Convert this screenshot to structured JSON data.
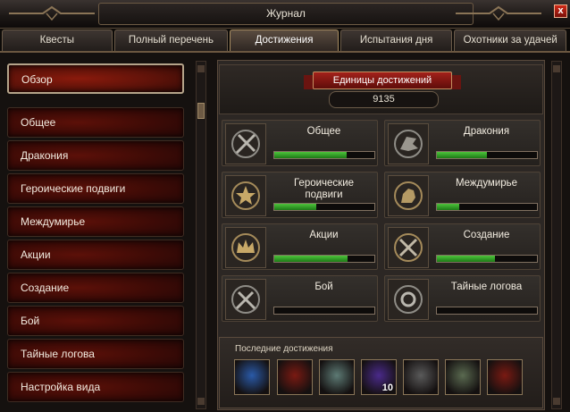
{
  "window": {
    "title": "Журнал",
    "close_label": "x"
  },
  "tabs": [
    {
      "label": "Квесты",
      "active": false
    },
    {
      "label": "Полный перечень",
      "active": false
    },
    {
      "label": "Достижения",
      "active": true
    },
    {
      "label": "Испытания дня",
      "active": false
    },
    {
      "label": "Охотники за удачей",
      "active": false
    }
  ],
  "sidebar": {
    "items": [
      {
        "label": "Обзор",
        "selected": true
      },
      {
        "label": "Общее"
      },
      {
        "label": "Дракония"
      },
      {
        "label": "Героические подвиги"
      },
      {
        "label": "Междумирье"
      },
      {
        "label": "Акции"
      },
      {
        "label": "Создание"
      },
      {
        "label": "Бой"
      },
      {
        "label": "Тайные логова"
      },
      {
        "label": "Настройка вида"
      }
    ]
  },
  "summary": {
    "title": "Единицы достижений",
    "points": "9135"
  },
  "categories": [
    {
      "label": "Общее",
      "icon": "crossed-sword-emblem-icon",
      "progress": 0.72
    },
    {
      "label": "Дракония",
      "icon": "dragon-head-emblem-icon",
      "progress": 0.5
    },
    {
      "label": "Героические\nподвиги",
      "icon": "star-medal-emblem-icon",
      "progress": 0.42
    },
    {
      "label": "Междумирье",
      "icon": "rider-emblem-icon",
      "progress": 0.22
    },
    {
      "label": "Акции",
      "icon": "crown-emblem-icon",
      "progress": 0.73
    },
    {
      "label": "Создание",
      "icon": "crossed-tools-emblem-icon",
      "progress": 0.58
    },
    {
      "label": "Бой",
      "icon": "crossed-swords-emblem-icon",
      "progress": 0
    },
    {
      "label": "Тайные логова",
      "icon": "lair-seal-emblem-icon",
      "progress": 0
    }
  ],
  "recent": {
    "label": "Последние достижения",
    "items": [
      {
        "icon": "blue-spirit-icon",
        "color": "#2a5aa8"
      },
      {
        "icon": "red-demon-icon",
        "color": "#7a1a12"
      },
      {
        "icon": "silver-dragon-icon",
        "color": "#5d7a74"
      },
      {
        "icon": "purple-sorcerer-icon",
        "color": "#4a2a8a",
        "badge": "10"
      },
      {
        "icon": "fire-emblem-icon",
        "color": "#5a5a5a"
      },
      {
        "icon": "swamp-creature-icon",
        "color": "#5a6a50"
      },
      {
        "icon": "red-knight-icon",
        "color": "#7a1a12"
      }
    ]
  }
}
